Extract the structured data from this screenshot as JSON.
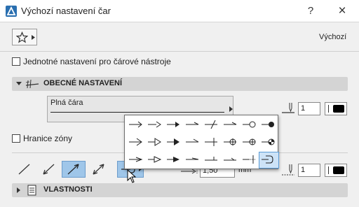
{
  "window": {
    "title": "Výchozí nastavení čar",
    "help_label": "?",
    "close_label": "×"
  },
  "favorites": {
    "preset_label": "Výchozí",
    "icon": "star-icon"
  },
  "uniform_settings": {
    "label": "Jednotné nastavení pro čárové nástroje",
    "checked": false
  },
  "general_section": {
    "title": "OBECNÉ NASTAVENÍ",
    "expanded": true
  },
  "line_type": {
    "name": "Plná čára"
  },
  "pen": {
    "index": "1",
    "color": "#000000"
  },
  "zone_border": {
    "label": "Hranice zóny",
    "checked": false
  },
  "arrow_size": {
    "value": "1,50",
    "unit": "mm"
  },
  "end_pen": {
    "index": "1",
    "color": "#000000"
  },
  "properties_section": {
    "title": "VLASTNOSTI",
    "expanded": false
  },
  "arrowhead_popup": {
    "rows": 3,
    "columns": 8,
    "selected": "row-3-col-8"
  }
}
